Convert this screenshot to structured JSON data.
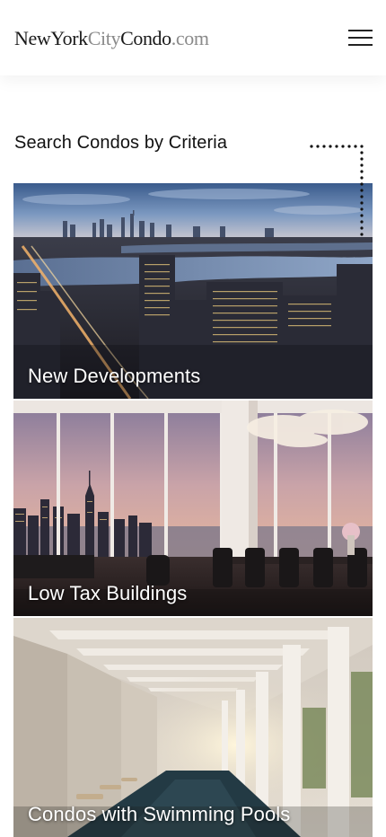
{
  "header": {
    "logo_part1": "NewYork",
    "logo_part2": "City",
    "logo_part3": "Condo",
    "logo_part4": ".com",
    "menu_icon": "hamburger-icon"
  },
  "section": {
    "title": "Search Condos by Criteria"
  },
  "cards": [
    {
      "label": "New Developments",
      "image": "skyline-dusk-photo"
    },
    {
      "label": "Low Tax Buildings",
      "image": "penthouse-interior-photo"
    },
    {
      "label": "Condos with Swimming Pools",
      "image": "indoor-pool-photo"
    }
  ],
  "colors": {
    "text": "#111111",
    "logo_light": "#8a8a8a",
    "caption": "#ffffff"
  }
}
